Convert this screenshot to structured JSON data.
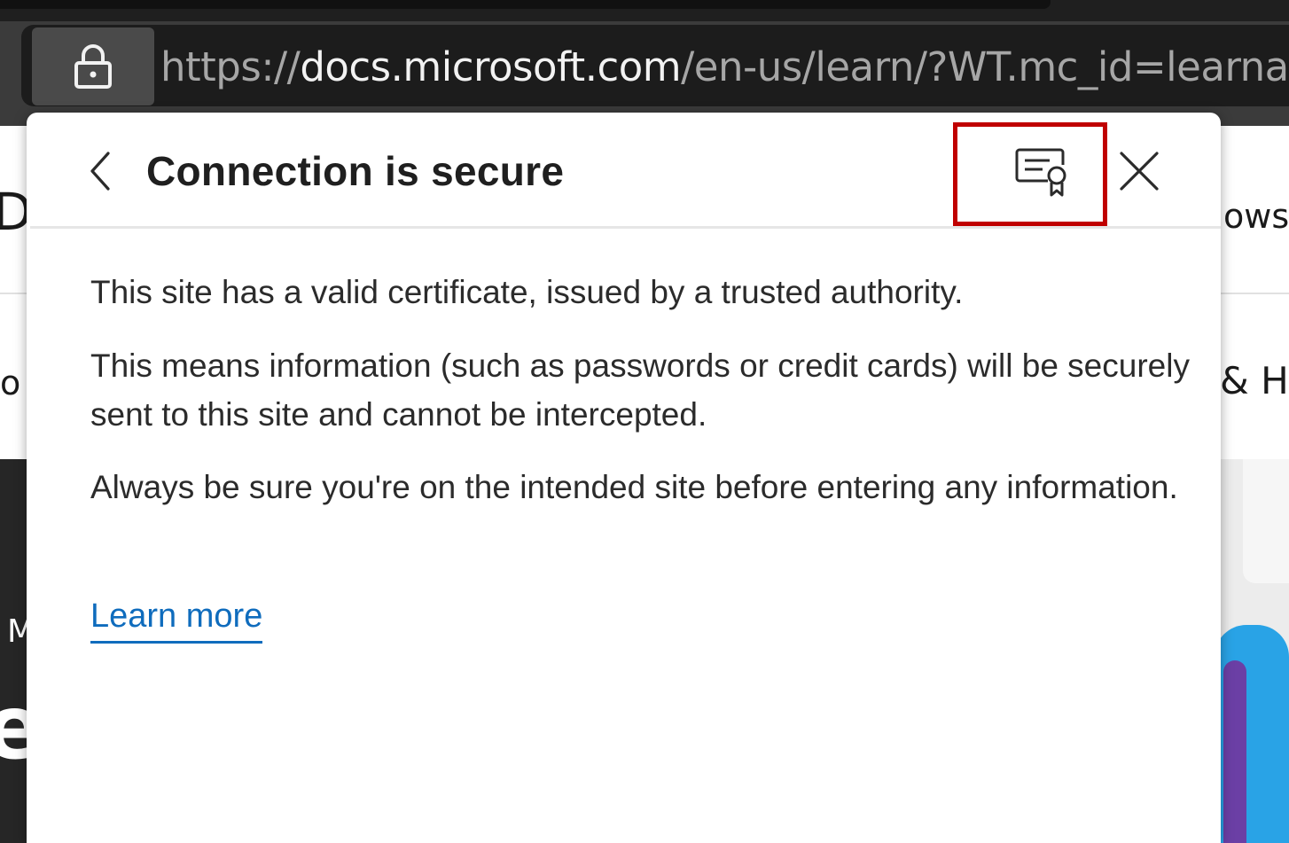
{
  "browser": {
    "url_prefix": "https://",
    "url_host": "docs.microsoft.com",
    "url_path": "/en-us/learn/?WT.mc_id=learnaka",
    "lock_icon": "lock-icon"
  },
  "background_page": {
    "text_a": "D",
    "text_b": "ows",
    "text_c": "o",
    "text_d": "& H",
    "text_e": "M",
    "text_f": "e"
  },
  "flyout": {
    "title": "Connection is secure",
    "back_icon": "chevron-left-icon",
    "certificate_icon": "certificate-icon",
    "close_icon": "close-icon",
    "paragraphs": [
      "This site has a valid certificate, issued by a trusted authority.",
      "This means information (such as passwords or credit cards) will be securely sent to this site and cannot be intercepted.",
      "Always be sure you're on the intended site before entering any information."
    ],
    "learn_more": "Learn more",
    "colors": {
      "highlight": "#c00000",
      "link": "#0f6cbd"
    }
  }
}
